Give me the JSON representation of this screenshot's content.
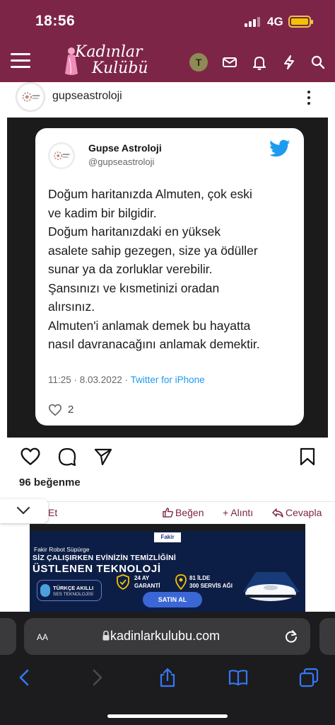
{
  "status_bar": {
    "time": "18:56",
    "network": "4G"
  },
  "site_header": {
    "logo_line1": "Kadınlar",
    "logo_line2": "Kulübü",
    "user_initial": "T"
  },
  "post": {
    "username": "gupseastroloji",
    "likes_text": "96 beğenme"
  },
  "tweet": {
    "display_name": "Gupse Astroloji",
    "handle": "@gupseastroloji",
    "lines": [
      "Doğum haritanızda Almuten, çok eski",
      "ve kadim bir bilgidir.",
      "Doğum haritanızdaki en yüksek",
      "asalete sahip gezegen, size ya ödüller",
      "sunar ya da zorluklar verebilir.",
      "Şansınızı ve kısmetinizi oradan",
      "alırsınız.",
      "Almuten'i anlamak demek bu hayatta",
      "nasıl davranacağını anlamak demektir."
    ],
    "timestamp": "11:25 · 8.03.2022 · ",
    "source": "Twitter for iPhone",
    "like_count": "2"
  },
  "forum_actions": {
    "et_label": "Et",
    "like_label": "Beğen",
    "quote_label": "+ Alıntı",
    "reply_label": "Cevapla"
  },
  "ad": {
    "brand": "Fakir",
    "subtitle": "Fakir Robot Süpürge",
    "headline1": "SİZ ÇALIŞIRKEN EVİNİZİN TEMİZLİĞİNİ",
    "headline2": "ÜSTLENEN TEKNOLOJİ",
    "feature1_title": "TÜRKÇE AKILLI",
    "feature1_sub": "SES TEKNOLOJİSİ",
    "guarantee_1": "24 AY",
    "guarantee_2": "GARANTİ",
    "service_1": "81 İLDE",
    "service_2": "300 SERVİS AĞI",
    "cta": "SATIN AL"
  },
  "browser": {
    "aa_label": "AA",
    "url": "kadinlarkulubu.com"
  },
  "colors": {
    "brand": "#7d2547",
    "twitter_blue": "#1d9bf0",
    "safari_bg": "#1c1c1e",
    "safari_tint": "#3478f6"
  }
}
